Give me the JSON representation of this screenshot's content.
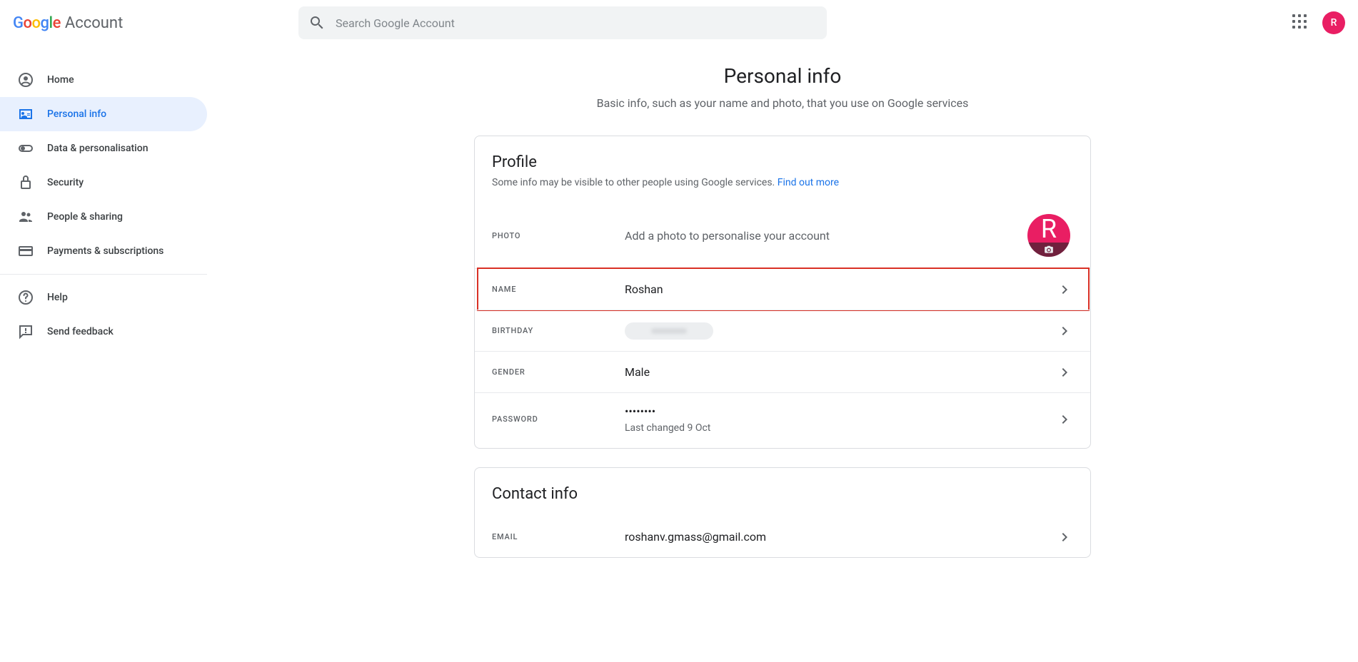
{
  "header": {
    "account_label": "Account",
    "search_placeholder": "Search Google Account",
    "avatar_letter": "R"
  },
  "sidebar": {
    "items": [
      {
        "label": "Home"
      },
      {
        "label": "Personal info"
      },
      {
        "label": "Data & personalisation"
      },
      {
        "label": "Security"
      },
      {
        "label": "People & sharing"
      },
      {
        "label": "Payments & subscriptions"
      }
    ],
    "help_label": "Help",
    "feedback_label": "Send feedback"
  },
  "page": {
    "title": "Personal info",
    "subtitle": "Basic info, such as your name and photo, that you use on Google services"
  },
  "profile": {
    "title": "Profile",
    "subtitle_text": "Some info may be visible to other people using Google services. ",
    "subtitle_link": "Find out more",
    "photo_label": "PHOTO",
    "photo_text": "Add a photo to personalise your account",
    "photo_letter": "R",
    "name_label": "NAME",
    "name_value": "Roshan",
    "birthday_label": "BIRTHDAY",
    "gender_label": "GENDER",
    "gender_value": "Male",
    "password_label": "PASSWORD",
    "password_value": "••••••••",
    "password_sub": "Last changed 9 Oct"
  },
  "contact": {
    "title": "Contact info",
    "email_label": "EMAIL",
    "email_value": "roshanv.gmass@gmail.com"
  }
}
